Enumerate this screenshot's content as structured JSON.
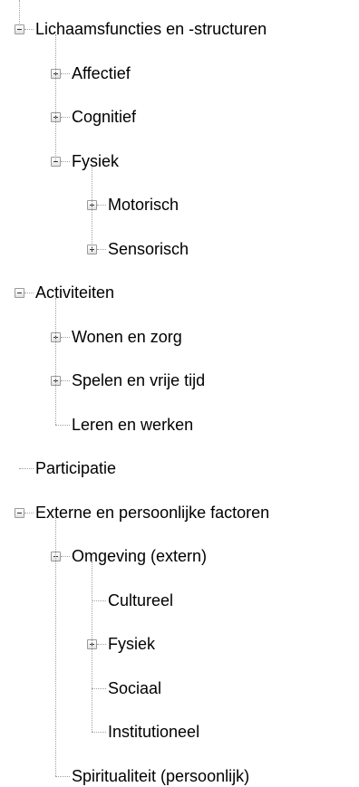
{
  "tree": [
    {
      "label": "Lichaamsfuncties en -structuren",
      "expanded": true,
      "children": [
        {
          "label": "Affectief",
          "expanded": false,
          "has_children": true
        },
        {
          "label": "Cognitief",
          "expanded": false,
          "has_children": true
        },
        {
          "label": "Fysiek",
          "expanded": true,
          "children": [
            {
              "label": "Motorisch",
              "expanded": false,
              "has_children": true
            },
            {
              "label": "Sensorisch",
              "expanded": false,
              "has_children": true
            }
          ]
        }
      ]
    },
    {
      "label": "Activiteiten",
      "expanded": true,
      "children": [
        {
          "label": "Wonen en zorg",
          "expanded": false,
          "has_children": true
        },
        {
          "label": "Spelen en vrije tijd",
          "expanded": false,
          "has_children": true
        },
        {
          "label": "Leren en werken",
          "has_children": false
        }
      ]
    },
    {
      "label": "Participatie",
      "has_children": false
    },
    {
      "label": "Externe en persoonlijke factoren",
      "expanded": true,
      "children": [
        {
          "label": "Omgeving (extern)",
          "expanded": true,
          "children": [
            {
              "label": "Cultureel",
              "has_children": false
            },
            {
              "label": "Fysiek",
              "expanded": false,
              "has_children": true
            },
            {
              "label": "Sociaal",
              "has_children": false
            },
            {
              "label": "Institutioneel",
              "has_children": false
            }
          ]
        },
        {
          "label": "Spiritualiteit (persoonlijk)",
          "has_children": false
        }
      ]
    }
  ]
}
